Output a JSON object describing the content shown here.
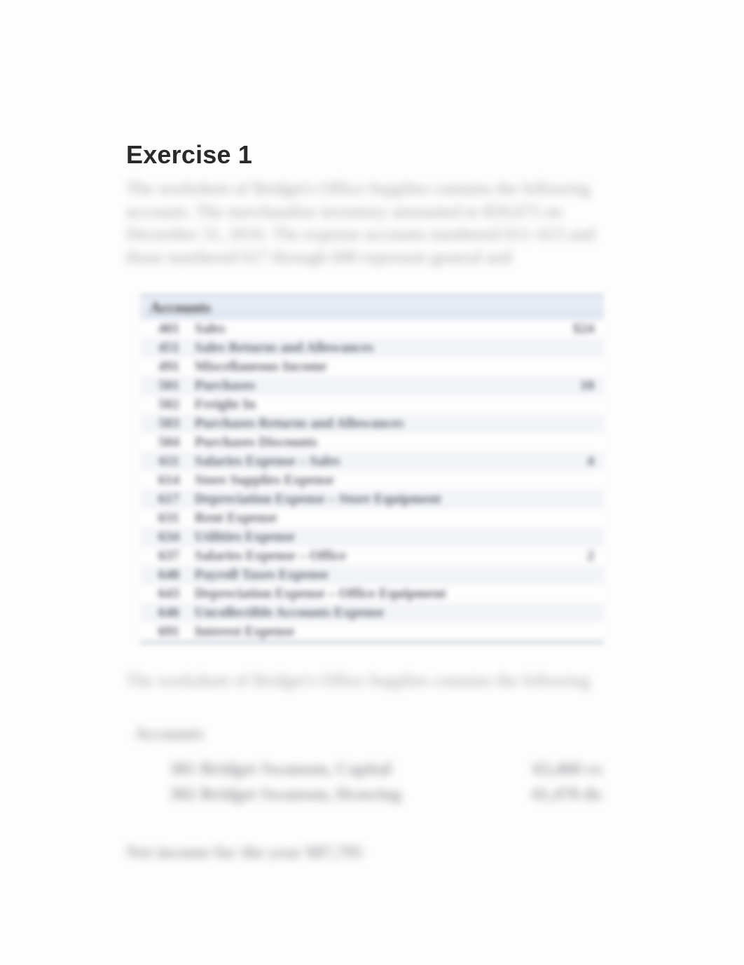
{
  "heading": "Exercise 1",
  "paragraph": "The worksheet of Bridget's Office Supplies contains the following accounts. The merchandise inventory amounted to $59,675 on December 31, 2016. The expense accounts numbered 611–615 and those numbered 617 through 690 represent general and",
  "table": {
    "header": "Accounts",
    "rows": [
      {
        "num": "401",
        "name": "Sales",
        "amt": "$24"
      },
      {
        "num": "451",
        "name": "Sales Returns and Allowances",
        "amt": ""
      },
      {
        "num": "491",
        "name": "Miscellaneous Income",
        "amt": ""
      },
      {
        "num": "501",
        "name": "Purchases",
        "amt": "10"
      },
      {
        "num": "502",
        "name": "Freight In",
        "amt": ""
      },
      {
        "num": "503",
        "name": "Purchases Returns and Allowances",
        "amt": ""
      },
      {
        "num": "504",
        "name": "Purchases Discounts",
        "amt": ""
      },
      {
        "num": "611",
        "name": "Salaries Expense – Sales",
        "amt": "4"
      },
      {
        "num": "614",
        "name": "Store Supplies Expense",
        "amt": ""
      },
      {
        "num": "617",
        "name": "Depreciation Expense – Store Equipment",
        "amt": ""
      },
      {
        "num": "631",
        "name": "Rent Expense",
        "amt": ""
      },
      {
        "num": "634",
        "name": "Utilities Expense",
        "amt": ""
      },
      {
        "num": "637",
        "name": "Salaries Expense – Office",
        "amt": "2"
      },
      {
        "num": "640",
        "name": "Payroll Taxes Expense",
        "amt": ""
      },
      {
        "num": "643",
        "name": "Depreciation Expense – Office Equipment",
        "amt": ""
      },
      {
        "num": "646",
        "name": "Uncollectible Accounts Expense",
        "amt": ""
      },
      {
        "num": "691",
        "name": "Interest Expense",
        "amt": ""
      }
    ]
  },
  "body_line2": "The worksheet of Bridget's Office Supplies contains the following",
  "lower": {
    "heading": "Accounts",
    "rows": [
      {
        "label": "301 Bridget Swanson, Capital",
        "value": "63,460 cr."
      },
      {
        "label": "302 Bridget Swanson, Drawing",
        "value": "41,470 dr."
      }
    ]
  },
  "net_line": "Net income for the year $87,795"
}
